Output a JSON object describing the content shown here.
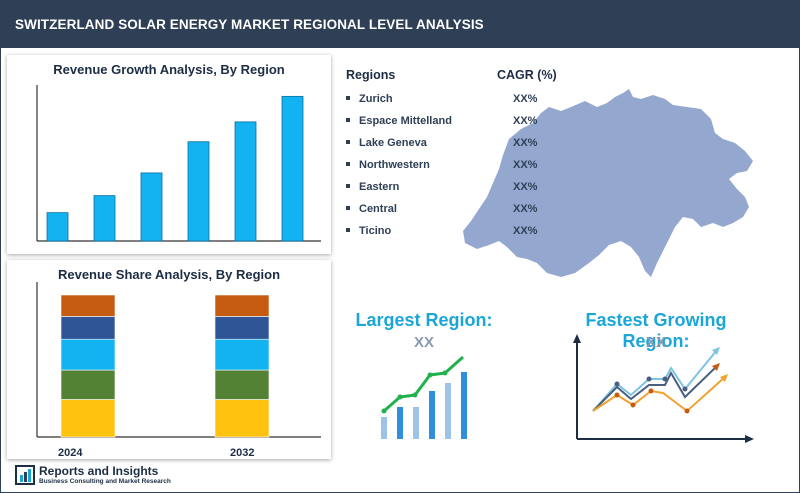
{
  "header": {
    "title": "SWITZERLAND SOLAR ENERGY MARKET REGIONAL LEVEL ANALYSIS"
  },
  "growth_panel": {
    "title": "Revenue Growth Analysis, By Region"
  },
  "share_panel": {
    "title": "Revenue Share Analysis, By Region"
  },
  "regions_table": {
    "regions_header": "Regions",
    "cagr_header": "CAGR (%)",
    "rows": [
      {
        "region": "Zurich",
        "cagr": "XX%"
      },
      {
        "region": "Espace Mittelland",
        "cagr": "XX%"
      },
      {
        "region": "Lake Geneva",
        "cagr": "XX%"
      },
      {
        "region": "Northwestern",
        "cagr": "XX%"
      },
      {
        "region": "Eastern",
        "cagr": "XX%"
      },
      {
        "region": "Central",
        "cagr": "XX%"
      },
      {
        "region": "Ticino",
        "cagr": "XX%"
      }
    ]
  },
  "largest_region": {
    "title": "Largest Region:",
    "value": "XX"
  },
  "fastest_region": {
    "title": "Fastest Growing Region:",
    "value": "XX"
  },
  "logo": {
    "name": "Reports and Insights",
    "tagline": "Business Consulting and Market Research"
  },
  "colors": {
    "header": "#2e3f56",
    "bar": "#13b2f0",
    "accent_blue": "#19a6d9",
    "map": "#94a8cf",
    "stack": [
      "#ffc20e",
      "#548235",
      "#13b2f0",
      "#2f5597",
      "#c55a11"
    ]
  },
  "chart_data": [
    {
      "type": "bar",
      "title": "Revenue Growth Analysis, By Region",
      "values": [
        1.0,
        1.6,
        2.4,
        3.5,
        4.2,
        5.1
      ],
      "xlabel": "",
      "ylabel": "",
      "grid": false
    },
    {
      "type": "bar",
      "stacked": true,
      "title": "Revenue Share Analysis, By Region",
      "categories": [
        "2024",
        "2032"
      ],
      "series": [
        {
          "values": [
            28,
            28
          ]
        },
        {
          "values": [
            22,
            22
          ]
        },
        {
          "values": [
            23,
            23
          ]
        },
        {
          "values": [
            17,
            17
          ]
        },
        {
          "values": [
            16,
            16
          ]
        }
      ],
      "grid": false
    }
  ]
}
